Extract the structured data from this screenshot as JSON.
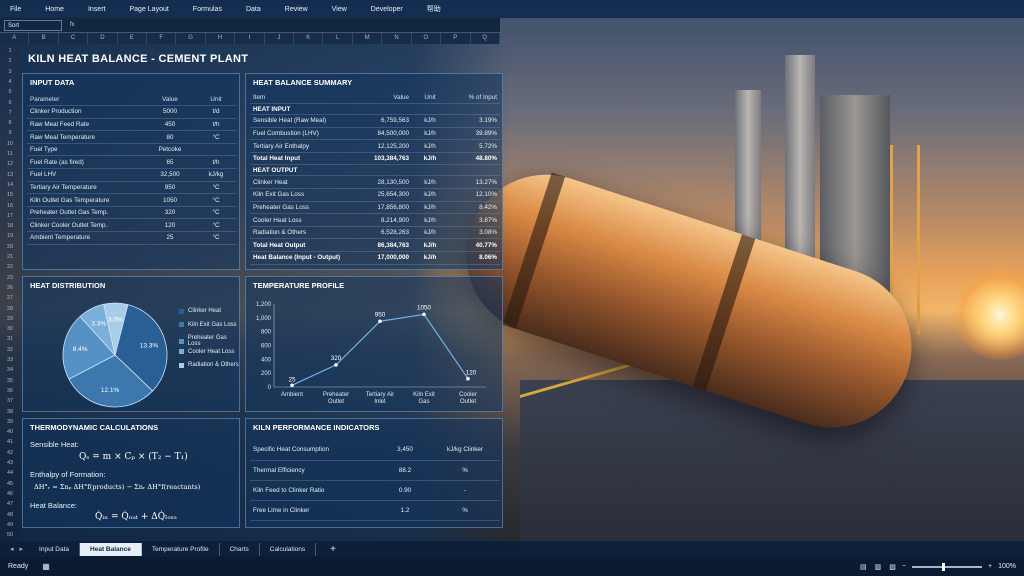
{
  "ribbon": [
    "File",
    "Home",
    "Insert",
    "Page Layout",
    "Formulas",
    "Data",
    "Review",
    "View",
    "Developer",
    "帮助"
  ],
  "namebox": "Sort",
  "fx": "fx",
  "columns": [
    "A",
    "B",
    "C",
    "D",
    "E",
    "F",
    "G",
    "H",
    "I",
    "J",
    "K",
    "L",
    "M",
    "N",
    "O",
    "P",
    "Q"
  ],
  "rows": [
    "1",
    "2",
    "3",
    "4",
    "5",
    "6",
    "7",
    "8",
    "9",
    "10",
    "11",
    "12",
    "13",
    "14",
    "15",
    "16",
    "17",
    "18",
    "19",
    "20",
    "21",
    "22",
    "23",
    "26",
    "27",
    "28",
    "29",
    "30",
    "31",
    "32",
    "33",
    "34",
    "35",
    "36",
    "37",
    "38",
    "39",
    "40",
    "41",
    "42",
    "43",
    "44",
    "45",
    "46",
    "47",
    "48",
    "49",
    "50"
  ],
  "title": "KILN HEAT BALANCE - CEMENT PLANT",
  "input": {
    "title": "INPUT DATA",
    "headers": [
      "Parameter",
      "Value",
      "Unit"
    ],
    "rows": [
      [
        "Clinker Production",
        "5000",
        "t/d"
      ],
      [
        "Raw Meal Feed Rate",
        "450",
        "t/h"
      ],
      [
        "Raw Meal Temperature",
        "80",
        "°C"
      ],
      [
        "Fuel Type",
        "Petcoke",
        ""
      ],
      [
        "Fuel Rate (as fired)",
        "65",
        "t/h"
      ],
      [
        "Fuel LHV",
        "32,500",
        "kJ/kg"
      ],
      [
        "Tertiary Air Temperature",
        "950",
        "°C"
      ],
      [
        "Kiln Outlet Gas Temperature",
        "1050",
        "°C"
      ],
      [
        "Preheater Outlet Gas Temp.",
        "320",
        "°C"
      ],
      [
        "Clinker Cooler Outlet Temp.",
        "120",
        "°C"
      ],
      [
        "Ambient Temperature",
        "25",
        "°C"
      ]
    ]
  },
  "summary": {
    "title": "HEAT BALANCE SUMMARY",
    "headers": [
      "Item",
      "Value",
      "Unit",
      "% of Input"
    ],
    "input_label": "HEAT INPUT",
    "input_rows": [
      [
        "Sensible Heat (Raw Meal)",
        "6,759,563",
        "kJ/h",
        "3.19%"
      ],
      [
        "Fuel Combustion (LHV)",
        "84,500,000",
        "kJ/h",
        "39.89%"
      ],
      [
        "Tertiary Air Enthalpy",
        "12,125,200",
        "kJ/h",
        "5.72%"
      ]
    ],
    "input_total": [
      "Total Heat Input",
      "103,384,763",
      "kJ/h",
      "48.80%"
    ],
    "output_label": "HEAT OUTPUT",
    "output_rows": [
      [
        "Clinker Heat",
        "28,130,500",
        "kJ/h",
        "13.27%"
      ],
      [
        "Kiln Exit Gas Loss",
        "25,654,300",
        "kJ/h",
        "12.10%"
      ],
      [
        "Preheater Gas Loss",
        "17,856,800",
        "kJ/h",
        "8.42%"
      ],
      [
        "Cooler Heat Loss",
        "8,214,900",
        "kJ/h",
        "3.87%"
      ],
      [
        "Radiation & Others",
        "6,528,263",
        "kJ/h",
        "3.08%"
      ]
    ],
    "output_total": [
      "Total Heat Output",
      "86,384,763",
      "kJ/h",
      "40.77%"
    ],
    "balance": [
      "Heat Balance (Input - Output)",
      "17,000,000",
      "kJ/h",
      "8.06%"
    ]
  },
  "distribution": {
    "title": "HEAT DISTRIBUTION",
    "legend": [
      "Clinker Heat",
      "Kiln Exit Gas Loss",
      "Preheater Gas Loss",
      "Cooler Heat Loss",
      "Radiation & Others"
    ],
    "colors": [
      "#2a5f95",
      "#3c77ad",
      "#5591c4",
      "#7aafd8",
      "#a8cde9"
    ]
  },
  "temperature": {
    "title": "TEMPERATURE PROFILE"
  },
  "chart_data": [
    {
      "type": "pie",
      "title": "HEAT DISTRIBUTION",
      "categories": [
        "Clinker Heat",
        "Kiln Exit Gas Loss",
        "Preheater Gas Loss",
        "Cooler Heat Loss",
        "Radiation & Others"
      ],
      "values": [
        13.3,
        12.1,
        8.4,
        3.3,
        3.0
      ],
      "labels": [
        "13.3%",
        "12.1%",
        "8.4%",
        "3.3%",
        "3.0%"
      ]
    },
    {
      "type": "line",
      "title": "TEMPERATURE PROFILE",
      "categories": [
        "Ambient",
        "Preheater Outlet",
        "Tertiary Air Inlet",
        "Kiln Exit Gas",
        "Cooler Outlet"
      ],
      "category_lines": [
        [
          "Ambient"
        ],
        [
          "Preheater",
          "Outlet"
        ],
        [
          "Tertiary Air",
          "Inlet"
        ],
        [
          "Kiln Exit",
          "Gas"
        ],
        [
          "Cooler",
          "Outlet"
        ]
      ],
      "values": [
        25,
        320,
        950,
        1050,
        120
      ],
      "yticks": [
        "0",
        "200",
        "400",
        "600",
        "800",
        "1,000",
        "1,200"
      ],
      "ylim": [
        0,
        1200
      ],
      "grid": false
    }
  ],
  "thermo": {
    "title": "THERMODYNAMIC CALCULATIONS",
    "l1": "Sensible Heat:",
    "e1": "Qₛ = m × Cₚ × (T₂ − T₁)",
    "l2": "Enthalpy of Formation:",
    "e2": "ΔH°ᵣ = Σnₚ ΔH°f(products) − Σnᵣ ΔH°f(reactants)",
    "l3": "Heat Balance:",
    "e3": "Q̇ᵢₙ = Q̇ₒᵤₜ + ΔQ̇ₗₒₛₛ"
  },
  "kpi": {
    "title": "KILN PERFORMANCE INDICATORS",
    "rows": [
      [
        "Specific Heat Consumption",
        "3,450",
        "kJ/kg Clinker"
      ],
      [
        "Thermal Efficiency",
        "88.2",
        "%"
      ],
      [
        "Kiln Feed to Clinker Ratio",
        "0.90",
        "-"
      ],
      [
        "Free Lime in Clinker",
        "1.2",
        "%"
      ]
    ]
  },
  "tabs": [
    "Input Data",
    "Heat Balance",
    "Temperature Profile",
    "Charts",
    "Calculations"
  ],
  "active_tab": "Heat Balance",
  "status": {
    "ready": "Ready",
    "zoom": "100%"
  }
}
